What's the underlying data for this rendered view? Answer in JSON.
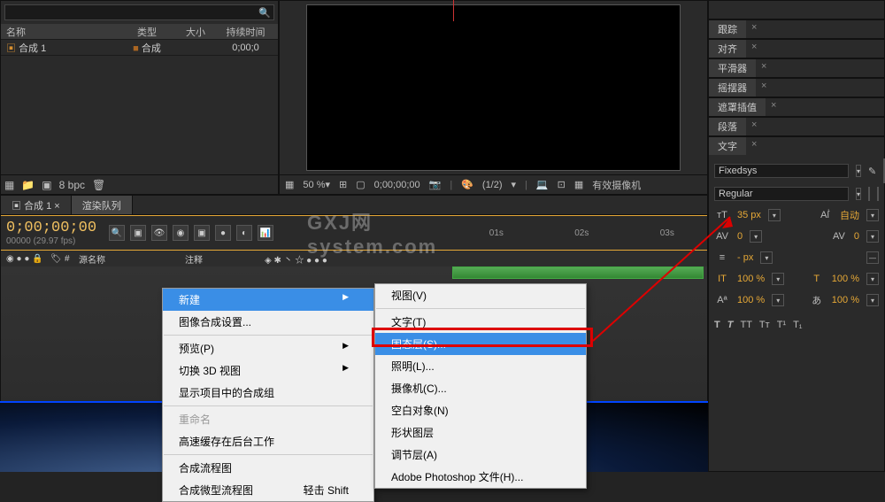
{
  "project": {
    "search_placeholder": "",
    "cols": {
      "name": "名称",
      "type": "类型",
      "size": "大小",
      "duration": "持续时间"
    },
    "items": [
      {
        "name": "合成 1",
        "type": "合成",
        "duration": "0;00;0"
      }
    ],
    "footer": {
      "bpc": "8 bpc"
    }
  },
  "viewer": {
    "zoom": "50 %",
    "time": "0;00;00;00",
    "ratio": "(1/2)",
    "camera": "有效摄像机"
  },
  "timeline": {
    "tabs": [
      "合成 1",
      "渲染队列"
    ],
    "timecode": "0;00;00;00",
    "fps": "00000 (29.97 fps)",
    "col_source": "源名称",
    "col_note": "注释",
    "ticks": [
      "01s",
      "02s",
      "03s"
    ],
    "watermark": "GXJ网 system.com"
  },
  "right_panels": {
    "tracking": "跟踪",
    "align": "对齐",
    "smoother": "平滑器",
    "wiggler": "摇摆器",
    "mask_interp": "遮罩插值",
    "paragraph": "段落",
    "character": "文字",
    "font": "Fixedsys",
    "weight": "Regular",
    "size": "35 px",
    "leading_auto": "自动",
    "kerning": "0",
    "tracking_val": "0",
    "stroke": "- px",
    "pct1": "100 %",
    "pct2": "100 %",
    "pct3": "100 %",
    "pct4": "100 %"
  },
  "context_menu_left": [
    {
      "label": "新建",
      "sub": true,
      "hl": true
    },
    {
      "label": "图像合成设置...",
      "sep_after": true
    },
    {
      "label": "预览(P)",
      "sub": true
    },
    {
      "label": "切换 3D 视图",
      "sub": true
    },
    {
      "label": "显示项目中的合成组",
      "sep_after": true
    },
    {
      "label": "重命名",
      "dis": true
    },
    {
      "label": "高速缓存在后台工作",
      "sep_after": true
    },
    {
      "label": "合成流程图"
    },
    {
      "label": "合成微型流程图",
      "shortcut": "轻击 Shift"
    }
  ],
  "context_menu_right": [
    {
      "label": "视图(V)",
      "sep_after": true
    },
    {
      "label": "文字(T)"
    },
    {
      "label": "固态层(S)...",
      "hl": true
    },
    {
      "label": "照明(L)..."
    },
    {
      "label": "摄像机(C)..."
    },
    {
      "label": "空白对象(N)"
    },
    {
      "label": "形状图层"
    },
    {
      "label": "调节层(A)"
    },
    {
      "label": "Adobe Photoshop 文件(H)..."
    }
  ]
}
